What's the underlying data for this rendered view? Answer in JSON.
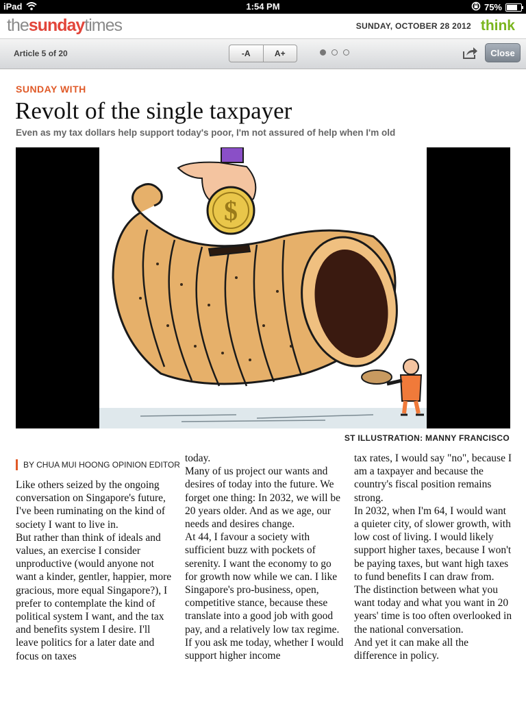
{
  "status_bar": {
    "carrier": "iPad",
    "time": "1:54 PM",
    "battery": "75%",
    "battery_level": 0.75
  },
  "masthead": {
    "logo_the": "the",
    "logo_sunday": "sunday",
    "logo_times": "times",
    "date": "SUNDAY, OCTOBER 28 2012",
    "section": "think"
  },
  "toolbar": {
    "article_count": "Article 5 of 20",
    "font_decrease": "-A",
    "font_increase": "A+",
    "pages": 3,
    "active_page": 1,
    "close_label": "Close"
  },
  "article": {
    "kicker": "SUNDAY WITH",
    "headline": "Revolt of the single taxpayer",
    "standfirst": "Even as my tax dollars help support today's poor, I'm not assured of help when I'm old",
    "illustration_credit": "ST ILLUSTRATION: MANNY FRANCISCO",
    "byline": "BY CHUA MUI HOONG OPINION EDITOR",
    "columns": [
      [
        "Like others seized by the ongoing conversation on Singapore's future, I've been ruminating on the kind of society I want to live in.",
        " But rather than think of ideals and values, an exercise I consider unproductive (would anyone not want a kinder, gentler, happier, more gracious, more equal Singapore?), I prefer to contemplate the kind of political system I want, and the tax and benefits system I desire. I'll leave politics for a later date and focus on taxes"
      ],
      [
        "today.",
        " Many of us project our wants and desires of today into the future. We forget one thing: In 2032, we will be 20 years older. And as we age, our needs and desires change.",
        " At 44, I favour a society with sufficient buzz with pockets of serenity. I want the economy to go for growth now while we can. I like Singapore's pro-business, open, competitive stance, because these translate into a good job with good pay, and a relatively low tax regime.",
        " If you ask me today, whether I would support higher income"
      ],
      [
        "tax rates, I would say \"no\", because I am a taxpayer and because the country's fiscal position remains strong.",
        " In 2032, when I'm 64, I would want a quieter city, of slower growth, with low cost of living. I would likely support higher taxes, because I won't be paying taxes, but want high taxes to fund benefits I can draw from.",
        " The distinction between what you want today and what you want in 20 years' time is too often overlooked in the national conversation.",
        " And yet it can make all the difference in policy."
      ]
    ]
  }
}
